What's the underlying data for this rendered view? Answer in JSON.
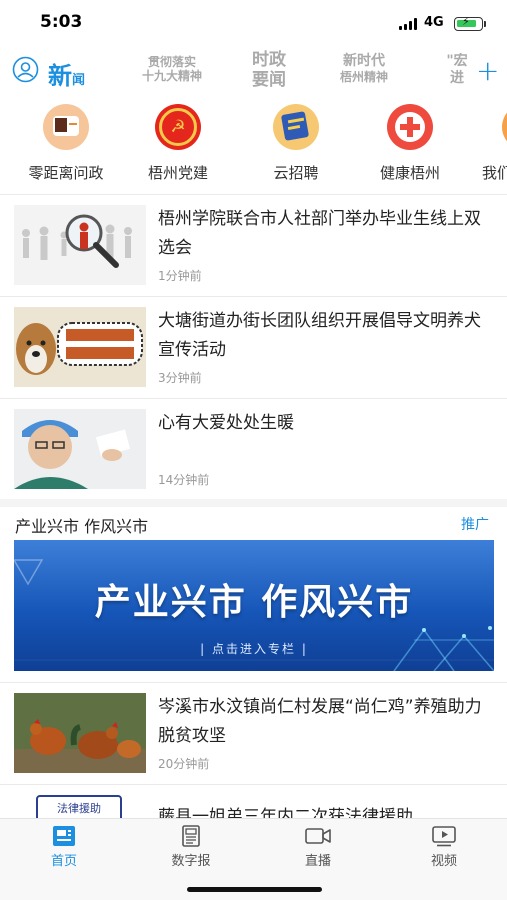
{
  "status_bar": {
    "time": "5:03",
    "network": "4G"
  },
  "channels": {
    "active": {
      "big": "新",
      "small": "闻"
    },
    "items": [
      {
        "l1": "贯彻落实",
        "l2": "十九大精神"
      },
      {
        "l1": "时政",
        "l2": "要闻"
      },
      {
        "l1": "新时代",
        "l2": "梧州精神"
      },
      {
        "l1": "\"宏",
        "l2": "进"
      }
    ]
  },
  "shortcuts": [
    {
      "label": "零距离问政",
      "icon": "chat-icon",
      "color": "#f2a35a"
    },
    {
      "label": "梧州党建",
      "icon": "party-emblem-icon",
      "color": "#e0281e"
    },
    {
      "label": "云招聘",
      "icon": "recruit-icon",
      "color": "#f3a43a"
    },
    {
      "label": "健康梧州",
      "icon": "medical-cross-icon",
      "color": "#ee4238"
    },
    {
      "label": "我们",
      "icon": "partial-icon",
      "color": "#f39a3a"
    }
  ],
  "news": [
    {
      "title": "梧州学院联合市人社部门举办毕业生线上双选会",
      "time": "1分钟前",
      "thumb": "job-fair-image"
    },
    {
      "title": "大塘街道办街长团队组织开展倡导文明养犬宣传活动",
      "time": "3分钟前",
      "thumb": "dog-campaign-image"
    },
    {
      "title": "心有大爱处处生暖",
      "time": "14分钟前",
      "thumb": "doctor-image"
    }
  ],
  "section": {
    "title": "产业兴市 作风兴市",
    "promo_label": "推广",
    "banner_title": "产业兴市  作风兴市",
    "banner_sub": "| 点击进入专栏 |"
  },
  "news_after": [
    {
      "title": "岑溪市水汶镇尚仁村发展“尚仁鸡”养殖助力脱贫攻坚",
      "time": "20分钟前",
      "thumb": "chicken-image"
    },
    {
      "title": "藤县一姐弟三年内二次获法律援助",
      "badge": "法律援助",
      "thumb": "legal-aid-image"
    }
  ],
  "tabs": [
    {
      "label": "首页",
      "icon": "home-icon",
      "active": true
    },
    {
      "label": "数字报",
      "icon": "newspaper-icon",
      "active": false
    },
    {
      "label": "直播",
      "icon": "video-camera-icon",
      "active": false
    },
    {
      "label": "视频",
      "icon": "play-screen-icon",
      "active": false
    }
  ],
  "colors": {
    "accent": "#1c8fe0",
    "muted": "#aaaaaa"
  }
}
